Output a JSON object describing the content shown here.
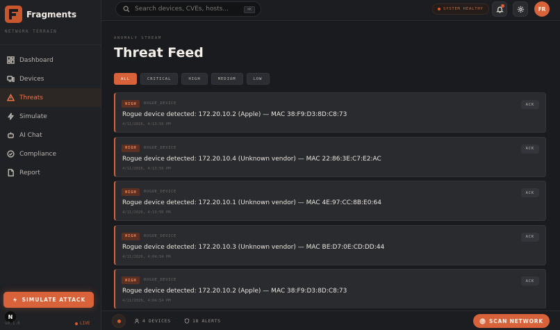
{
  "brand": {
    "name": "Fragments",
    "subtitle": "NETWORK TERRAIN"
  },
  "sidebar": {
    "items": [
      {
        "label": "Dashboard",
        "icon": "dashboard-icon"
      },
      {
        "label": "Devices",
        "icon": "devices-icon"
      },
      {
        "label": "Threats",
        "icon": "warning-icon",
        "active": true
      },
      {
        "label": "Simulate",
        "icon": "bolt-icon"
      },
      {
        "label": "AI Chat",
        "icon": "bot-icon"
      },
      {
        "label": "Compliance",
        "icon": "check-circle-icon"
      },
      {
        "label": "Report",
        "icon": "document-icon"
      }
    ],
    "simulate_label": "SIMULATE ATTACK",
    "version": "v0.1.0",
    "live_label": "LIVE",
    "n_badge": "N"
  },
  "search": {
    "placeholder": "Search devices, CVEs, hosts...",
    "shortcut": "⌘K"
  },
  "topbar": {
    "health_label": "SYSTEM HEALTHY",
    "avatar_initials": "FR"
  },
  "main": {
    "eyebrow": "ANOMALY STREAM",
    "title": "Threat Feed",
    "filters": [
      "ALL",
      "CRITICAL",
      "HIGH",
      "MEDIUM",
      "LOW"
    ],
    "active_filter": "ALL",
    "ack_label": "ACK",
    "threats": [
      {
        "severity": "HIGH",
        "type": "ROGUE_DEVICE",
        "message": "Rogue device detected: 172.20.10.2 (Apple) — MAC 38:F9:D3:8D:C8:73",
        "time": "4/11/2026, 4:13:56 PM"
      },
      {
        "severity": "HIGH",
        "type": "ROGUE_DEVICE",
        "message": "Rogue device detected: 172.20.10.4 (Unknown vendor) — MAC 22:86:3E:C7:E2:AC",
        "time": "4/11/2026, 4:13:56 PM"
      },
      {
        "severity": "HIGH",
        "type": "ROGUE_DEVICE",
        "message": "Rogue device detected: 172.20.10.1 (Unknown vendor) — MAC 4E:97:CC:8B:E0:64",
        "time": "4/11/2026, 4:13:56 PM"
      },
      {
        "severity": "HIGH",
        "type": "ROGUE_DEVICE",
        "message": "Rogue device detected: 172.20.10.3 (Unknown vendor) — MAC BE:D7:0E:CD:DD:44",
        "time": "4/11/2026, 4:04:54 PM"
      },
      {
        "severity": "HIGH",
        "type": "ROGUE_DEVICE",
        "message": "Rogue device detected: 172.20.10.2 (Apple) — MAC 38:F9:D3:8D:C8:73",
        "time": "4/11/2026, 4:04:54 PM"
      }
    ]
  },
  "bottombar": {
    "devices": "4 DEVICES",
    "alerts": "18 ALERTS",
    "scan_label": "SCAN NETWORK"
  },
  "colors": {
    "accent": "#d8633a",
    "background": "#1a1b1e",
    "card": "#2a2b2f"
  }
}
